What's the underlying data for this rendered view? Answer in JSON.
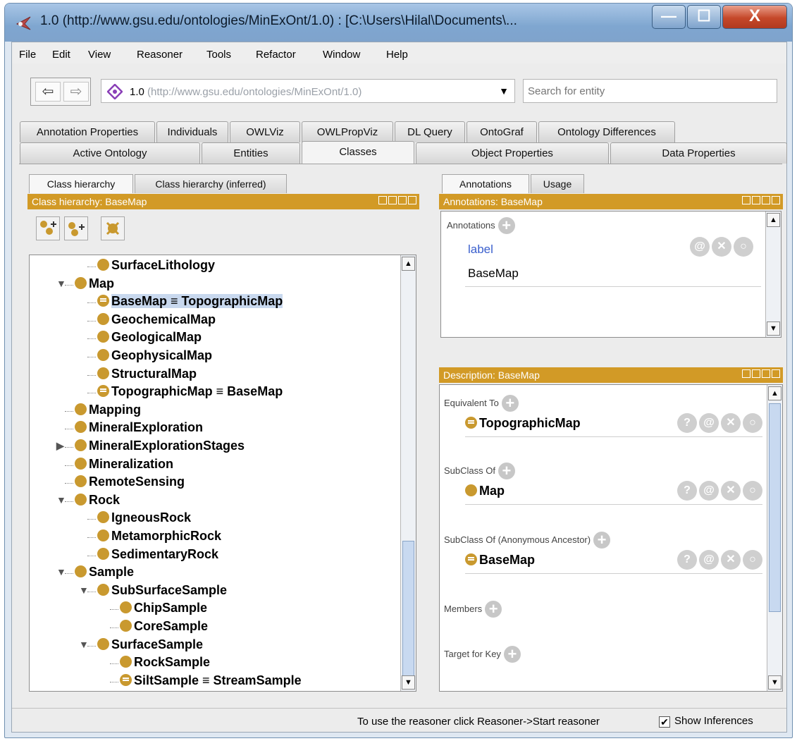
{
  "window": {
    "title": "1.0 (http://www.gsu.edu/ontologies/MinExOnt/1.0)  : [C:\\Users\\Hilal\\Documents\\...",
    "min_label": "—",
    "max_label": "☐",
    "close_label": "X"
  },
  "menu": [
    "File",
    "Edit",
    "View",
    "Reasoner",
    "Tools",
    "Refactor",
    "Window",
    "Help"
  ],
  "nav": {
    "back": "⇦",
    "forward": "⇨"
  },
  "address": {
    "ontology_name": "1.0",
    "ontology_url": "(http://www.gsu.edu/ontologies/MinExOnt/1.0)",
    "dropdown": "▼"
  },
  "search": {
    "placeholder": "Search for entity"
  },
  "tabs_row1": [
    "Annotation Properties",
    "Individuals",
    "OWLViz",
    "OWLPropViz",
    "DL Query",
    "OntoGraf",
    "Ontology Differences"
  ],
  "tabs_row2": [
    "Active Ontology",
    "Entities",
    "Classes",
    "Object Properties",
    "Data Properties"
  ],
  "active_tab": "Classes",
  "left_panel": {
    "subtabs": [
      "Class hierarchy",
      "Class hierarchy (inferred)"
    ],
    "header": "Class hierarchy: BaseMap",
    "tree": [
      {
        "label": "SurfaceLithology",
        "depth": 1,
        "eq": false,
        "toggle": ""
      },
      {
        "label": "Map",
        "depth": 0,
        "eq": false,
        "toggle": "▼"
      },
      {
        "label": "BaseMap ≡ TopographicMap",
        "depth": 1,
        "eq": true,
        "toggle": "",
        "selected": true
      },
      {
        "label": "GeochemicalMap",
        "depth": 1,
        "eq": false,
        "toggle": ""
      },
      {
        "label": "GeologicalMap",
        "depth": 1,
        "eq": false,
        "toggle": ""
      },
      {
        "label": "GeophysicalMap",
        "depth": 1,
        "eq": false,
        "toggle": ""
      },
      {
        "label": "StructuralMap",
        "depth": 1,
        "eq": false,
        "toggle": ""
      },
      {
        "label": "TopographicMap ≡ BaseMap",
        "depth": 1,
        "eq": true,
        "toggle": ""
      },
      {
        "label": "Mapping",
        "depth": 0,
        "eq": false,
        "toggle": ""
      },
      {
        "label": "MineralExploration",
        "depth": 0,
        "eq": false,
        "toggle": ""
      },
      {
        "label": "MineralExplorationStages",
        "depth": 0,
        "eq": false,
        "toggle": "▶"
      },
      {
        "label": "Mineralization",
        "depth": 0,
        "eq": false,
        "toggle": ""
      },
      {
        "label": "RemoteSensing",
        "depth": 0,
        "eq": false,
        "toggle": ""
      },
      {
        "label": "Rock",
        "depth": 0,
        "eq": false,
        "toggle": "▼"
      },
      {
        "label": "IgneousRock",
        "depth": 1,
        "eq": false,
        "toggle": ""
      },
      {
        "label": "MetamorphicRock",
        "depth": 1,
        "eq": false,
        "toggle": ""
      },
      {
        "label": "SedimentaryRock",
        "depth": 1,
        "eq": false,
        "toggle": ""
      },
      {
        "label": "Sample",
        "depth": 0,
        "eq": false,
        "toggle": "▼"
      },
      {
        "label": "SubSurfaceSample",
        "depth": 1,
        "eq": false,
        "toggle": "▼"
      },
      {
        "label": "ChipSample",
        "depth": 2,
        "eq": false,
        "toggle": ""
      },
      {
        "label": "CoreSample",
        "depth": 2,
        "eq": false,
        "toggle": ""
      },
      {
        "label": "SurfaceSample",
        "depth": 1,
        "eq": false,
        "toggle": "▼"
      },
      {
        "label": "RockSample",
        "depth": 2,
        "eq": false,
        "toggle": ""
      },
      {
        "label": "SiltSample ≡ StreamSample",
        "depth": 2,
        "eq": true,
        "toggle": ""
      }
    ]
  },
  "right_panel": {
    "subtabs": [
      "Annotations",
      "Usage"
    ],
    "annotations_header": "Annotations: BaseMap",
    "annotations_label": "Annotations",
    "annotation_property": "label",
    "annotation_value": "BaseMap",
    "description_header": "Description: BaseMap",
    "sections": [
      {
        "title": "Equivalent To",
        "item": "TopographicMap",
        "eq": true
      },
      {
        "title": "SubClass Of",
        "item": "Map",
        "eq": false
      },
      {
        "title": "SubClass Of (Anonymous Ancestor)",
        "item": "BaseMap",
        "eq": true
      },
      {
        "title": "Members",
        "item": "",
        "eq": false
      },
      {
        "title": "Target for Key",
        "item": "",
        "eq": false
      }
    ]
  },
  "status": {
    "message": "To use the reasoner click Reasoner->Start reasoner",
    "show_inferences": "Show Inferences",
    "checked": "✔"
  },
  "colors": {
    "accent": "#d29a26",
    "class_dot": "#c9992f",
    "selection": "#c8d8ee"
  }
}
